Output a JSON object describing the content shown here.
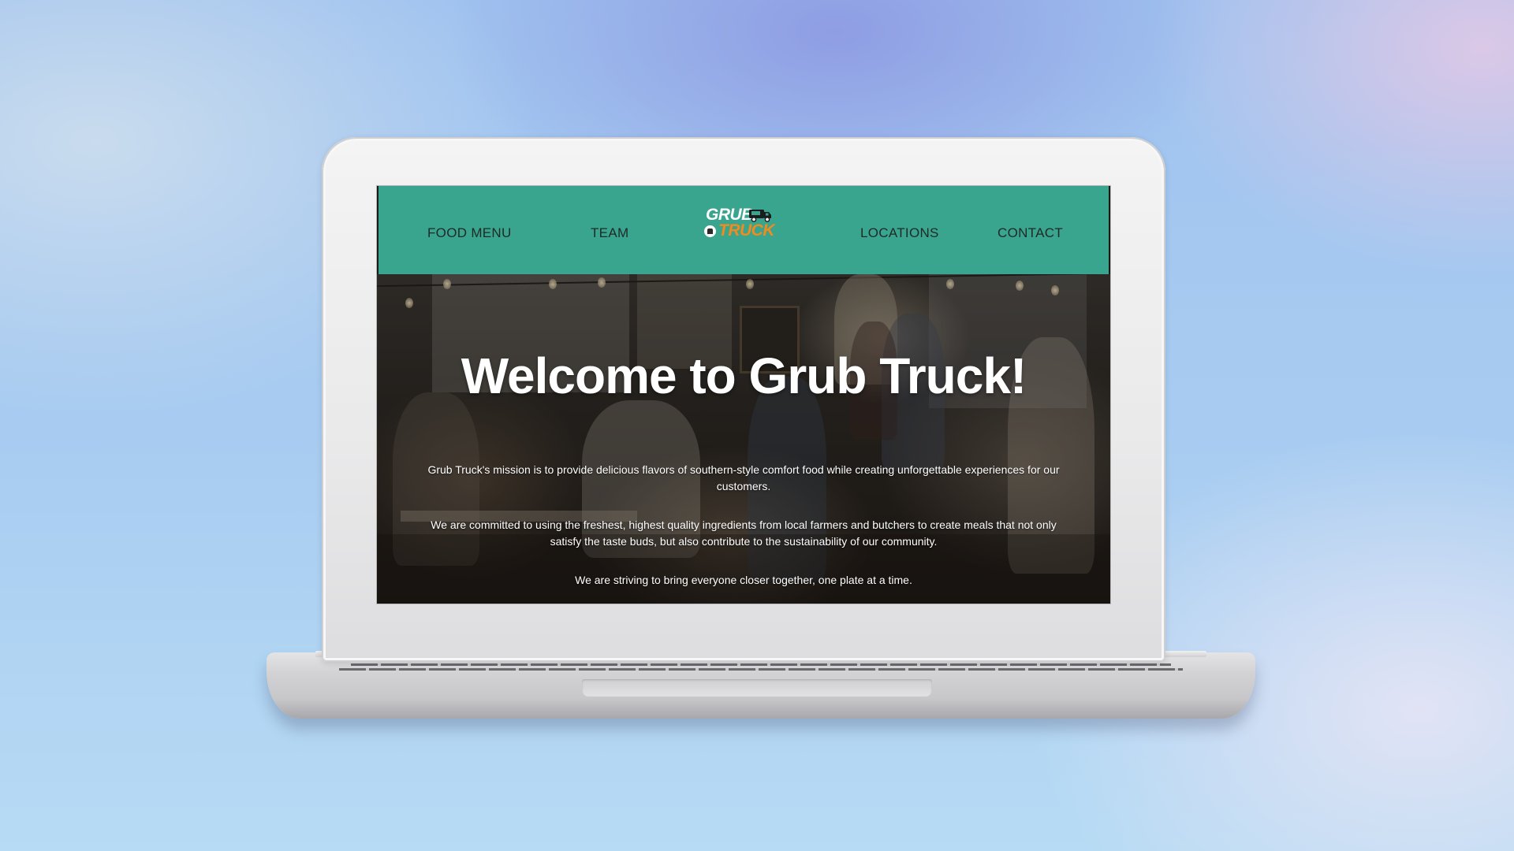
{
  "nav": {
    "items": [
      "FOOD MENU",
      "TEAM",
      "LOCATIONS",
      "CONTACT"
    ],
    "logo_line1": "GRUB",
    "logo_line2": "TRUCK"
  },
  "hero": {
    "title": "Welcome to Grub Truck!",
    "paragraphs": [
      "Grub Truck's mission is to provide delicious flavors of southern-style comfort food while creating unforgettable experiences for our customers.",
      "We are committed to using the freshest, highest quality ingredients from local farmers and butchers to create meals that not only satisfy the taste buds, but also contribute to the sustainability of our community.",
      "We are striving to bring everyone closer together, one plate at a time."
    ]
  },
  "colors": {
    "nav_background": "#3aa58e",
    "logo_white": "#ffffff",
    "logo_orange": "#f28a1e",
    "nav_text": "#1f2a27"
  },
  "icons": [
    "grub-truck-logo",
    "food-truck-icon"
  ]
}
